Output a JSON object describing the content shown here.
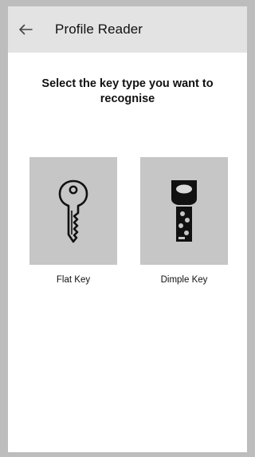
{
  "app_bar": {
    "title": "Profile Reader",
    "back_icon": "arrow-left-icon"
  },
  "headline": "Select the key type you want to recognise",
  "key_options": [
    {
      "label": "Flat Key",
      "icon": "flat-key-icon"
    },
    {
      "label": "Dimple Key",
      "icon": "dimple-key-icon"
    }
  ],
  "colors": {
    "app_bar_background": "#e3e3e3",
    "tile_background": "#c6c6c6",
    "outer_frame": "#bdbdbd",
    "text": "#111111"
  }
}
